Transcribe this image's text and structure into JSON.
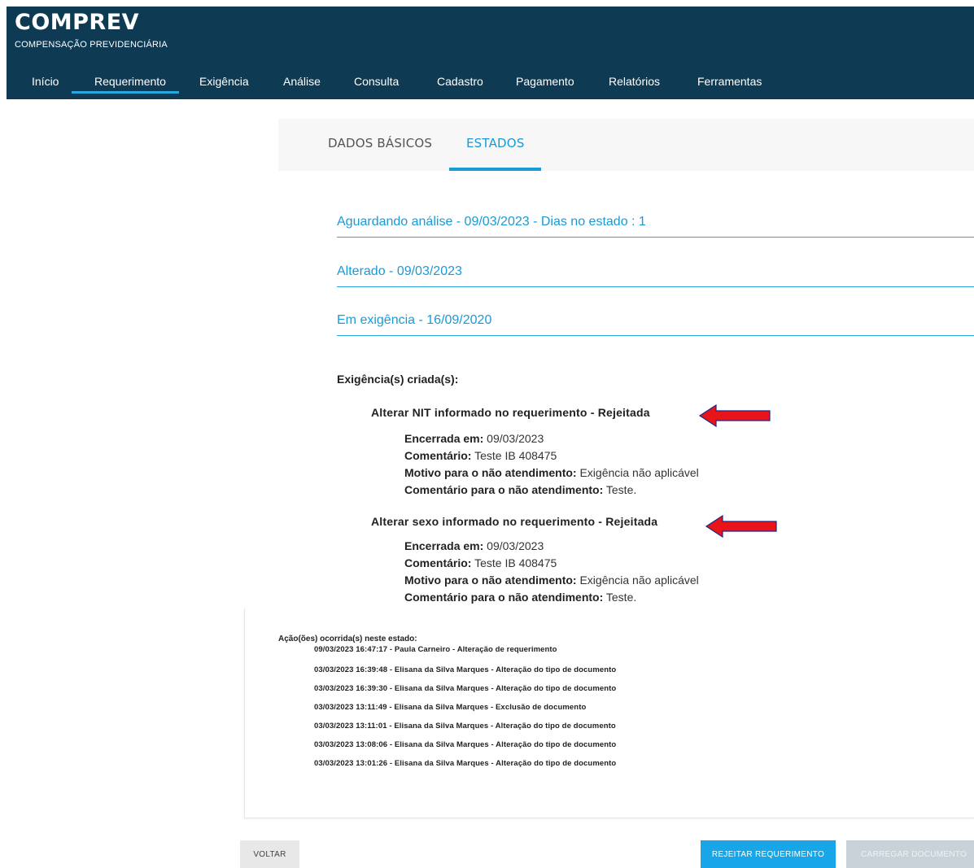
{
  "app": {
    "title": "COMPREV",
    "subtitle": "COMPENSAÇÃO PREVIDENCIÁRIA",
    "colors": {
      "header_bg": "#0e3a54",
      "accent": "#1a9ad6",
      "arrow": "#e8141a"
    }
  },
  "nav": {
    "items": [
      {
        "label": "Início"
      },
      {
        "label": "Requerimento"
      },
      {
        "label": "Exigência"
      },
      {
        "label": "Análise"
      },
      {
        "label": "Consulta"
      },
      {
        "label": "Cadastro"
      },
      {
        "label": "Pagamento"
      },
      {
        "label": "Relatórios"
      },
      {
        "label": "Ferramentas"
      }
    ],
    "active": "Requerimento"
  },
  "tabs": [
    {
      "label": "DADOS BÁSICOS"
    },
    {
      "label": "ESTADOS"
    }
  ],
  "active_tab": "ESTADOS",
  "states": [
    {
      "label": "Aguardando análise - 09/03/2023 - Dias no estado : 1"
    },
    {
      "label": "Alterado - 09/03/2023"
    },
    {
      "label": "Em exigência - 16/09/2020"
    }
  ],
  "exigencias": {
    "title": "Exigência(s) criada(s):",
    "items": [
      {
        "title": "Alterar NIT informado no requerimento - Rejeitada",
        "encerrada_label": "Encerrada em:",
        "encerrada_value": "09/03/2023",
        "comentario_label": "Comentário:",
        "comentario_value": "Teste IB 408475",
        "motivo_label": "Motivo para o não atendimento:",
        "motivo_value": "Exigência não aplicável",
        "comentario_nao_label": "Comentário para o não atendimento:",
        "comentario_nao_value": "Teste."
      },
      {
        "title": "Alterar sexo informado no requerimento - Rejeitada",
        "encerrada_label": "Encerrada em:",
        "encerrada_value": "09/03/2023",
        "comentario_label": "Comentário:",
        "comentario_value": "Teste IB 408475",
        "motivo_label": "Motivo para o não atendimento:",
        "motivo_value": "Exigência não aplicável",
        "comentario_nao_label": "Comentário para o não atendimento:",
        "comentario_nao_value": "Teste."
      }
    ]
  },
  "acoes": {
    "title": "Ação(ões) ocorrida(s) neste estado:",
    "items": [
      "09/03/2023 16:47:17 - Paula Carneiro - Alteração de requerimento",
      "03/03/2023 16:39:48 - Elisana da Silva Marques - Alteração do tipo de documento",
      "03/03/2023 16:39:30 - Elisana da Silva Marques - Alteração do tipo de documento",
      "03/03/2023 13:11:49 - Elisana da Silva Marques - Exclusão de documento",
      "03/03/2023 13:11:01 - Elisana da Silva Marques - Alteração do tipo de documento",
      "03/03/2023 13:08:06 - Elisana da Silva Marques - Alteração do tipo de documento",
      "03/03/2023 13:01:26 - Elisana da Silva Marques - Alteração do tipo de documento"
    ]
  },
  "buttons": {
    "voltar": "VOLTAR",
    "rejeitar": "REJEITAR REQUERIMENTO",
    "carregar": "CARREGAR DOCUMENTO"
  }
}
